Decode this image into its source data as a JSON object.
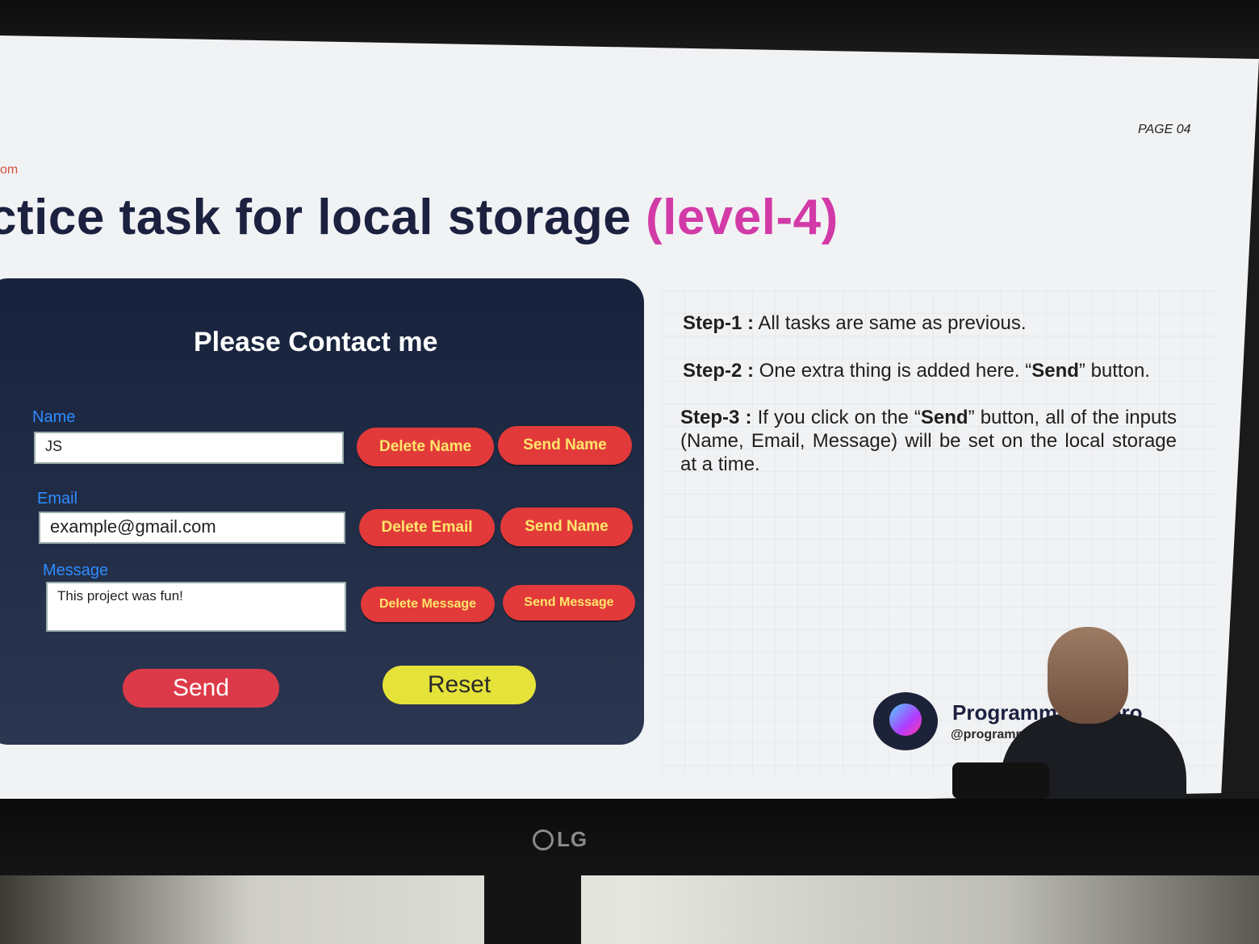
{
  "slide": {
    "page_number": "PAGE 04",
    "url_fragment": "om",
    "title_main": "ctice task for local storage",
    "title_accent": "(level-4)"
  },
  "form": {
    "title": "Please Contact me",
    "name_label": "Name",
    "name_value": "JS",
    "email_label": "Email",
    "email_value": "example@gmail.com",
    "message_label": "Message",
    "message_value": "This project was fun!",
    "buttons": {
      "delete_name": "Delete Name",
      "send_name": "Send Name",
      "delete_email": "Delete Email",
      "send_email": "Send Name",
      "delete_message": "Delete Message",
      "send_message": "Send Message",
      "send": "Send",
      "reset": "Reset"
    }
  },
  "steps": [
    {
      "label": "Step-1 :",
      "text": " All tasks are same as previous."
    },
    {
      "label": "Step-2 :",
      "text_before": " One extra thing is added here. “",
      "bold": "Send",
      "text_after": "” button."
    },
    {
      "label": "Step-3 :",
      "text_before": " If you click on the “",
      "bold": "Send",
      "text_after": "” button, all of the inputs (Name, Email, Message) will be set on the local storage at a time."
    }
  ],
  "branding": {
    "name": "Programming Hero",
    "handle": "@programminghero"
  },
  "monitor": {
    "brand": "LG"
  },
  "colors": {
    "title_dark": "#1c2140",
    "title_accent": "#d23aa7",
    "card_bg": "#17233d",
    "label_blue": "#2e8cff",
    "btn_red": "#e23a3a",
    "btn_text_yellow": "#ffe66b",
    "reset_yellow": "#e5e23a"
  }
}
